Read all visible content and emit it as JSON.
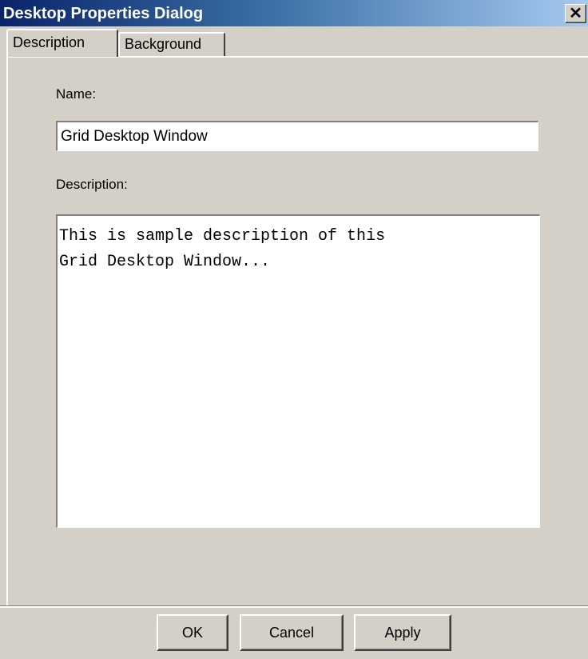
{
  "window": {
    "title": "Desktop Properties Dialog",
    "close_symbol": "✕"
  },
  "tabs": [
    {
      "label": "Description",
      "active": true
    },
    {
      "label": "Background",
      "active": false
    }
  ],
  "form": {
    "name_label": "Name:",
    "name_value": "Grid Desktop Window",
    "description_label": "Description:",
    "description_value": "This is sample description of this\nGrid Desktop Window..."
  },
  "buttons": {
    "ok": "OK",
    "cancel": "Cancel",
    "apply": "Apply"
  },
  "colors": {
    "title_gradient_start": "#0a246a",
    "title_gradient_end": "#a6caf0",
    "dialog_face": "#d4d0c8"
  }
}
